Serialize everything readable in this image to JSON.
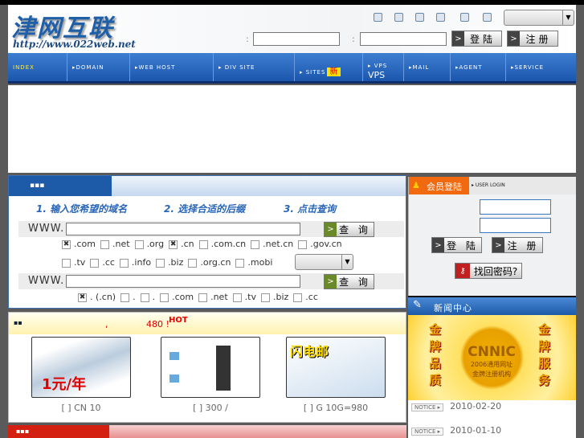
{
  "header": {
    "logo_cn": "津网互联",
    "logo_url": "http://www.022web.net",
    "colon1": ":",
    "colon2": ":",
    "login_btn": "登陆",
    "register_btn": "注册",
    "chevron": ">"
  },
  "top_icons": [
    "sitemap-icon",
    "info-icon",
    "doc-icon",
    "window-icon",
    "lock-icon",
    "window2-icon"
  ],
  "nav": [
    {
      "label": "INDEX"
    },
    {
      "label": "▸DOMAIN"
    },
    {
      "label": "▸WEB HOST"
    },
    {
      "label": "▸ DIV SITE"
    },
    {
      "label": "▸ SITES",
      "badge": "新"
    },
    {
      "label": "▸ VPS",
      "sub": "VPS"
    },
    {
      "label": "▸MAIL"
    },
    {
      "label": "▸AGENT"
    },
    {
      "label": "▸SERVICE"
    }
  ],
  "domain": {
    "tab": "▪▪▪",
    "steps": [
      "1. 输入您希望的域名",
      "2. 选择合适的后缀",
      "3. 点击查询"
    ],
    "www": "WWW.",
    "query_btn": "查 询",
    "row1": [
      {
        "t": ".com",
        "c": true
      },
      {
        "t": ".net",
        "c": false
      },
      {
        "t": ".org",
        "c": false
      },
      {
        "t": ".cn",
        "c": true
      },
      {
        "t": ".com.cn",
        "c": false
      },
      {
        "t": ".net.cn",
        "c": false
      },
      {
        "t": ".gov.cn",
        "c": false
      }
    ],
    "row2": [
      {
        "t": ".tv",
        "c": false
      },
      {
        "t": ".cc",
        "c": false
      },
      {
        "t": ".info",
        "c": false
      },
      {
        "t": ".biz",
        "c": false
      },
      {
        "t": ".org.cn",
        "c": false
      },
      {
        "t": ".mobi",
        "c": false
      }
    ],
    "row3": [
      {
        "t": ". (.cn)",
        "c": true
      },
      {
        "t": ".",
        "c": false
      },
      {
        "t": ".",
        "c": false
      },
      {
        "t": ".com",
        "c": false
      },
      {
        "t": ".net",
        "c": false
      },
      {
        "t": ".tv",
        "c": false
      },
      {
        "t": ".biz",
        "c": false
      },
      {
        "t": ".cc",
        "c": false
      }
    ]
  },
  "hot": {
    "icon": "▪▪",
    "comma": ",",
    "text": "480 !",
    "hot": "HOT",
    "products": [
      {
        "img": "1元/年",
        "caption": "[ ] CN 10"
      },
      {
        "img": "",
        "caption": "[ ]   300 /"
      },
      {
        "img": "闪电邮",
        "caption": "[ ] G 10G=980"
      }
    ]
  },
  "login": {
    "title": "会员登陆",
    "sub": "▸ USER LOGIN",
    "login_btn": "登 陆",
    "register_btn": "注 册",
    "forgot": "找回密码?"
  },
  "news": {
    "title": "新闻中心",
    "banner": {
      "left": "金牌品质",
      "right": "金牌服务",
      "brand": "CNNIC",
      "line1": "2006通用网址",
      "line2": "金牌注册机构"
    },
    "items": [
      {
        "badge": "NOTICE ▸",
        "date": "2010-02-20"
      },
      {
        "badge": "NOTICE ▸",
        "date": "2010-01-10"
      }
    ]
  }
}
